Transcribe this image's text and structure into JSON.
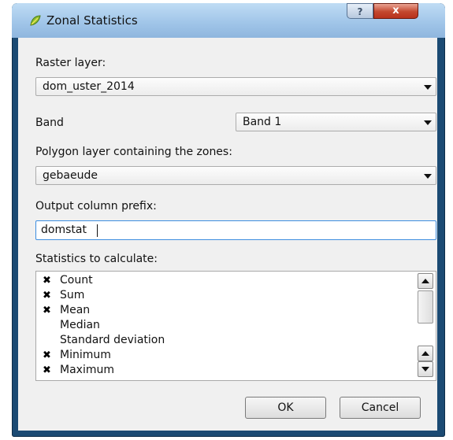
{
  "window": {
    "title": "Zonal Statistics",
    "help_label": "?",
    "close_label": "x"
  },
  "raster": {
    "label": "Raster layer:",
    "value": "dom_uster_2014"
  },
  "band": {
    "label": "Band",
    "value": "Band 1"
  },
  "polygon": {
    "label": "Polygon layer containing the zones:",
    "value": "gebaeude"
  },
  "prefix": {
    "label": "Output column prefix:",
    "value": "domstat"
  },
  "stats": {
    "label": "Statistics to calculate:",
    "check_glyph": "✖",
    "items": [
      {
        "label": "Count",
        "checked": true
      },
      {
        "label": "Sum",
        "checked": true
      },
      {
        "label": "Mean",
        "checked": true
      },
      {
        "label": "Median",
        "checked": false
      },
      {
        "label": "Standard deviation",
        "checked": false
      },
      {
        "label": "Minimum",
        "checked": true
      },
      {
        "label": "Maximum",
        "checked": true
      }
    ]
  },
  "buttons": {
    "ok": "OK",
    "cancel": "Cancel"
  }
}
